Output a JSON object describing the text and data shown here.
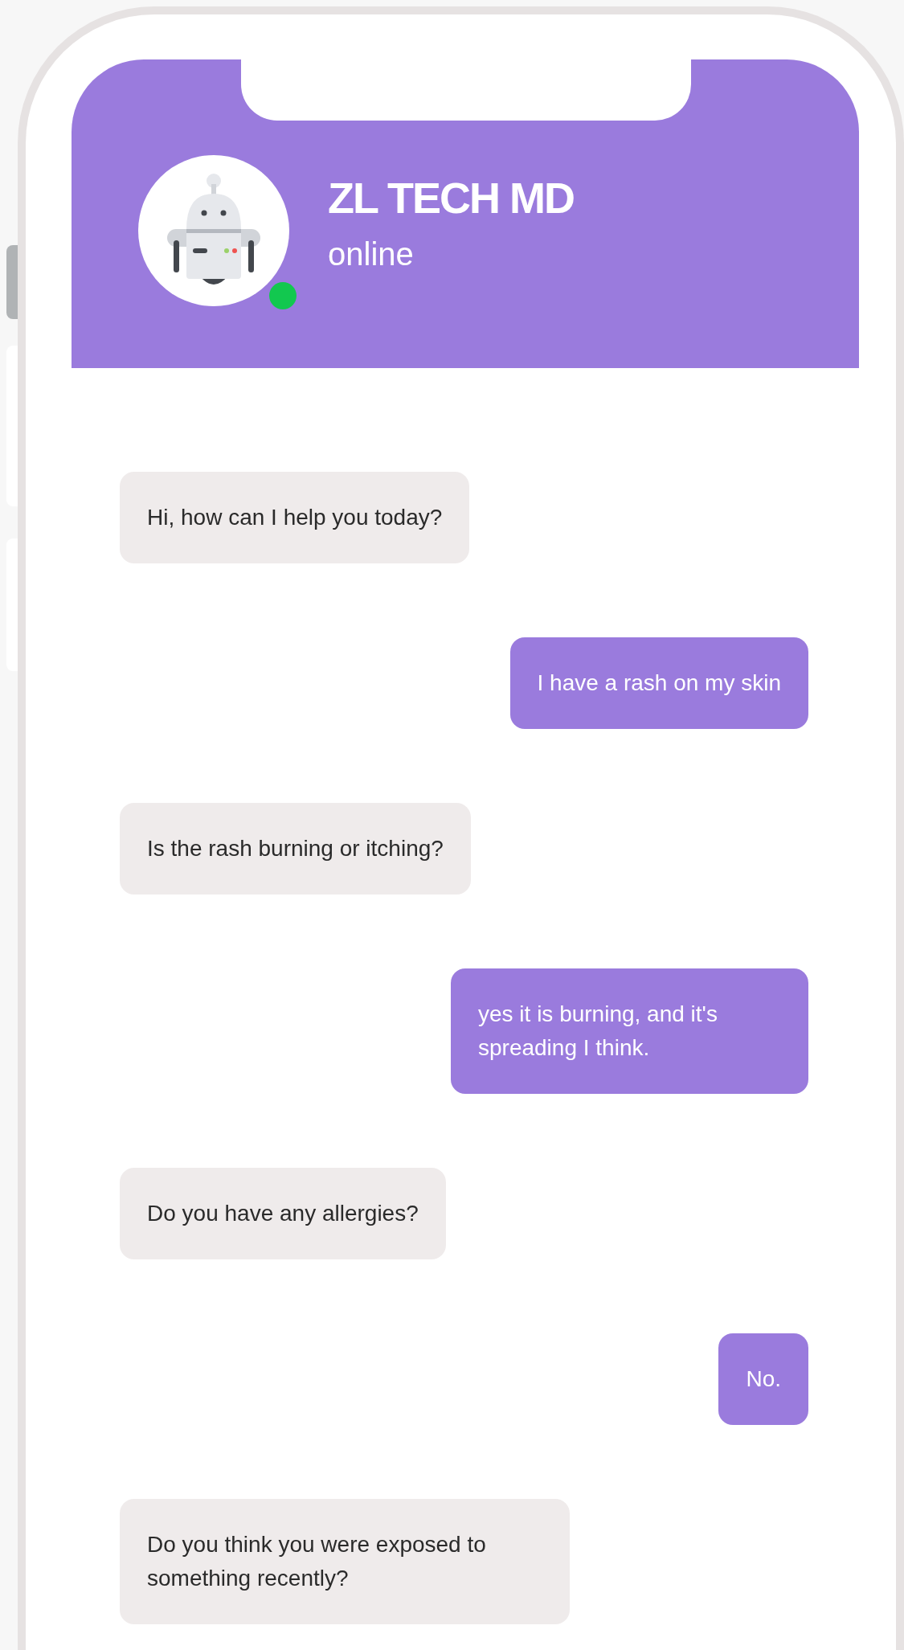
{
  "header": {
    "title": "ZL TECH MD",
    "status": "online",
    "online": true
  },
  "messages": [
    {
      "kind": "incoming",
      "text": "Hi, how can I help you today?"
    },
    {
      "kind": "outgoing",
      "text": "I have a rash on my skin"
    },
    {
      "kind": "incoming",
      "text": "Is the rash burning or itching?"
    },
    {
      "kind": "outgoing",
      "text": "yes it is burning, and it's spreading I think."
    },
    {
      "kind": "incoming",
      "text": "Do you have any allergies?"
    },
    {
      "kind": "outgoing",
      "text": "No."
    },
    {
      "kind": "incoming",
      "text": "Do you think you were exposed to something recently?"
    }
  ]
}
